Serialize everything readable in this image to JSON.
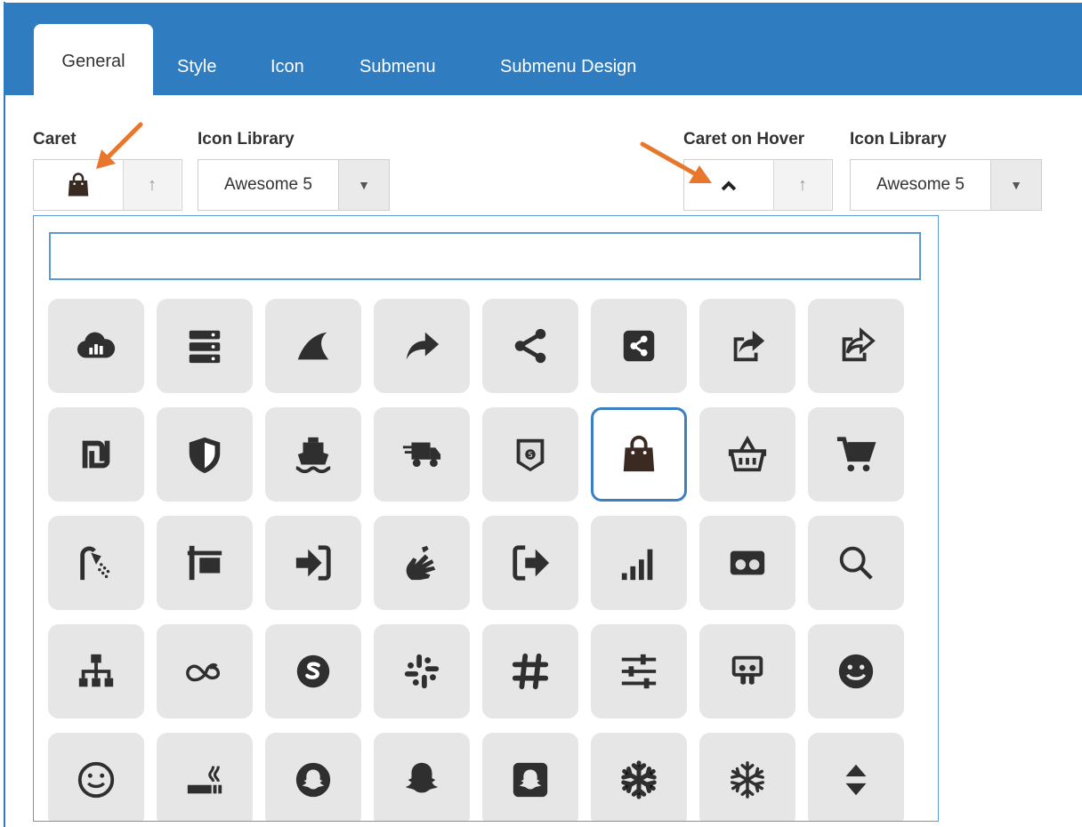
{
  "tabs": [
    {
      "label": "General",
      "active": true
    },
    {
      "label": "Style",
      "active": false
    },
    {
      "label": "Icon",
      "active": false
    },
    {
      "label": "Submenu",
      "active": false
    },
    {
      "label": "Submenu Design",
      "active": false
    }
  ],
  "caret": {
    "label": "Caret",
    "icon": "shopping-bag-icon",
    "library_label": "Icon Library",
    "library_value": "Awesome 5"
  },
  "caret_hover": {
    "label": "Caret on Hover",
    "icon": "chevron-up-icon",
    "library_label": "Icon Library",
    "library_value": "Awesome 5"
  },
  "search": {
    "value": "",
    "placeholder": ""
  },
  "icon_grid": {
    "selected": "shopping-bag-icon",
    "rows": [
      [
        "cloud-chart-icon",
        "server-icon",
        "shark-fin-icon",
        "share-arrow-icon",
        "share-alt-icon",
        "share-alt-square-icon",
        "share-square-icon",
        "share-square-outline-icon"
      ],
      [
        "shekel-icon",
        "shield-icon",
        "ship-icon",
        "shipping-fast-icon",
        "shirtsinbulk-icon",
        "shopping-bag-icon",
        "shopping-basket-icon",
        "shopping-cart-icon"
      ],
      [
        "shower-icon",
        "sign-icon",
        "sign-in-icon",
        "sign-language-icon",
        "sign-out-icon",
        "signal-icon",
        "simplybuilt-icon",
        "search-icon"
      ],
      [
        "sitemap-icon",
        "skyatlas-icon",
        "skype-icon",
        "slack-icon",
        "slack-hash-icon",
        "sliders-icon",
        "slideshare-icon",
        "smile-icon"
      ],
      [
        "smile-outline-icon",
        "smoking-icon",
        "snapchat-icon",
        "snapchat-ghost-icon",
        "snapchat-square-icon",
        "snowflake-icon",
        "snowflake-outline-icon",
        "sort-icon"
      ]
    ]
  },
  "colors": {
    "header": "#2f7cc1",
    "icon": "#2f2f2f",
    "selected_icon": "#3b2a22",
    "cell_bg": "#e6e6e6",
    "highlight": "#3b80c2",
    "annotation_arrow": "#e8772e"
  }
}
